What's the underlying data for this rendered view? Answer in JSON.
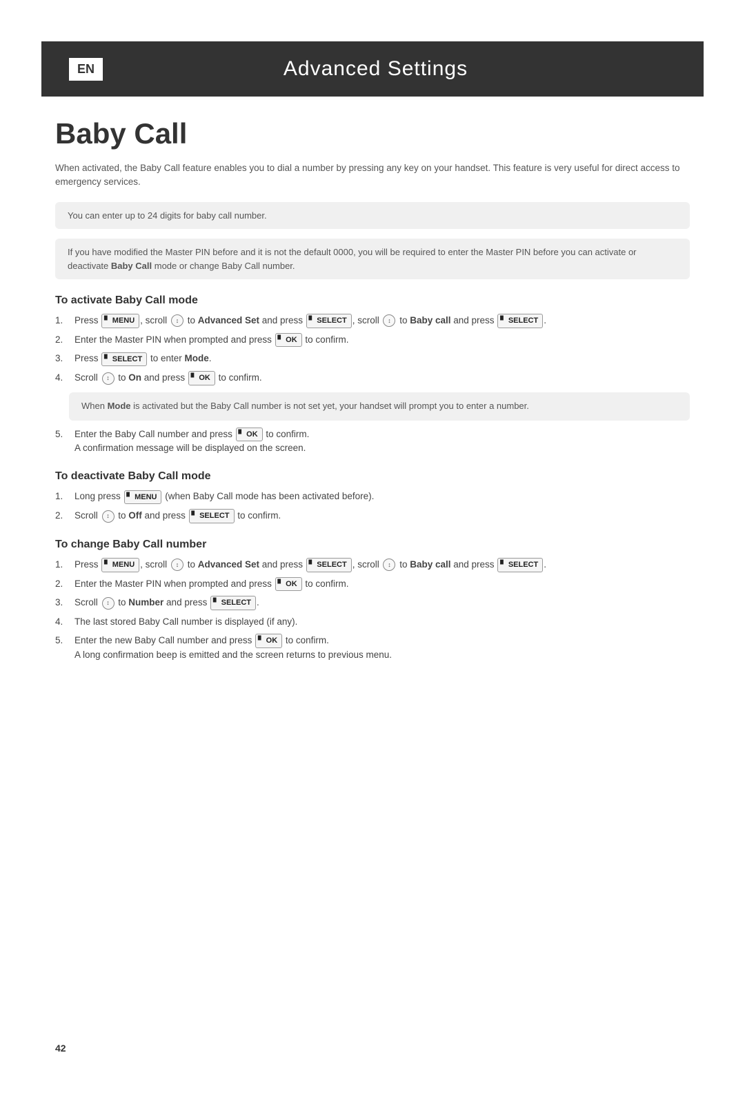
{
  "header": {
    "lang": "EN",
    "title": "Advanced Settings"
  },
  "page": {
    "title": "Baby Call",
    "intro": "When activated, the Baby Call feature enables you to dial a number by pressing any key on your handset. This feature is very useful for direct access to emergency services.",
    "note1": "You can enter up to 24 digits for baby call number.",
    "note2": "If you have modified the Master PIN before and it is not the default 0000, you will be required to enter the Master PIN before you can activate or deactivate Baby Call mode or change Baby Call number.",
    "section1": {
      "title": "To activate Baby Call mode",
      "steps": [
        "Press [MENU], scroll [scroll] to Advanced Set and press [SELECT], scroll [scroll] to Baby call and press [SELECT].",
        "Enter the Master PIN when prompted and press [OK] to confirm.",
        "Press [SELECT] to enter Mode.",
        "Scroll [scroll] to On and press [OK] to confirm."
      ],
      "note": "When Mode is activated but the Baby Call number is not set yet, your handset will prompt you to enter a number.",
      "step5": "Enter the Baby Call number and press [OK] to confirm.\nA confirmation message will be displayed on the screen."
    },
    "section2": {
      "title": "To deactivate Baby Call mode",
      "steps": [
        "Long press [MENU] (when Baby Call mode has been activated before).",
        "Scroll [scroll] to Off and press [SELECT] to confirm."
      ]
    },
    "section3": {
      "title": "To change Baby Call number",
      "steps": [
        "Press [MENU], scroll [scroll] to Advanced Set and press [SELECT], scroll [scroll] to Baby call and press [SELECT].",
        "Enter the Master PIN when prompted and press [OK] to confirm.",
        "Scroll [scroll] to Number and press [SELECT].",
        "The last stored Baby Call number is displayed (if any).",
        "Enter the new Baby Call number and press [OK] to confirm.\nA long confirmation beep is emitted and the screen returns to previous menu."
      ]
    },
    "page_number": "42"
  }
}
